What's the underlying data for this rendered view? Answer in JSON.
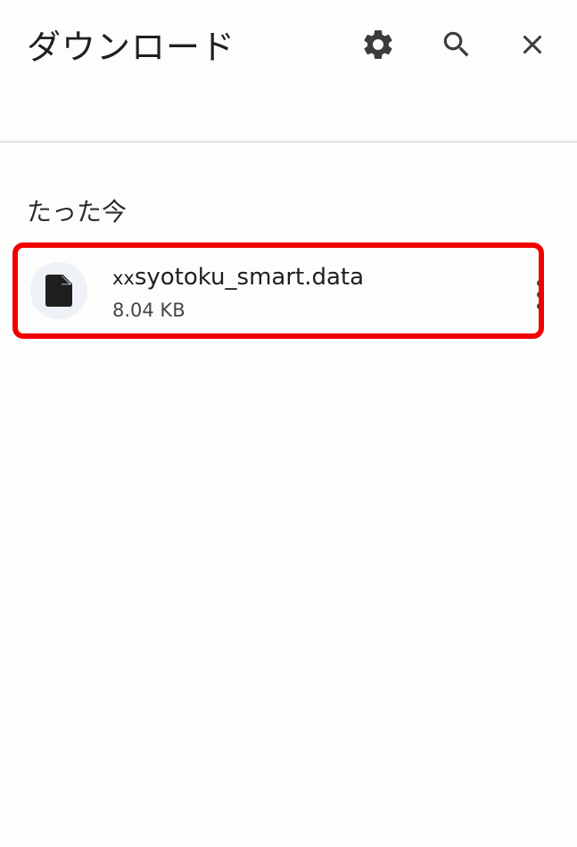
{
  "header": {
    "title": "ダウンロード",
    "settings_icon": "gear-icon",
    "search_icon": "search-icon",
    "close_icon": "close-icon"
  },
  "sections": [
    {
      "label": "たった今",
      "items": [
        {
          "prefix": "xx",
          "name": "syotoku_smart.data",
          "size": "8.04 KB",
          "icon": "file-icon",
          "menu_icon": "more-vert-icon",
          "highlighted": true,
          "highlight_color": "#f20000"
        }
      ]
    }
  ],
  "colors": {
    "background": "#fdfdfb",
    "icon": "#3c3c3c",
    "highlight": "#f20000"
  }
}
